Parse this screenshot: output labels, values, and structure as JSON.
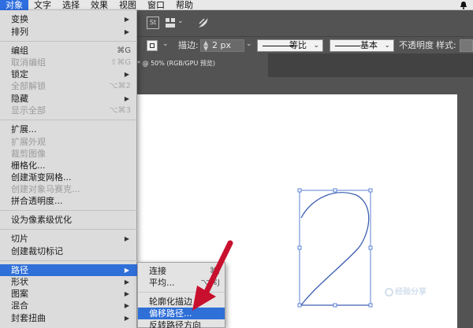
{
  "menubar": {
    "items": [
      "对象",
      "文字",
      "选择",
      "效果",
      "视图",
      "窗口",
      "帮助"
    ]
  },
  "controlbar": {
    "st_label": "St"
  },
  "optionsbar": {
    "stroke_label": "描边:",
    "stroke_value": "2 px",
    "profile1_label": "等比",
    "profile2_label": "基本",
    "opacity_label": "不透明度",
    "style_label": "样式:"
  },
  "document_tab": {
    "title": "* @ 50% (RGB/GPU 预览)"
  },
  "object_menu": {
    "transform": "变换",
    "arrange": "排列",
    "group": "编组",
    "group_sc": "⌘G",
    "ungroup": "取消编组",
    "ungroup_sc": "⇧⌘G",
    "lock": "锁定",
    "unlock_all": "全部解锁",
    "unlock_all_sc": "⌥⌘2",
    "hide": "隐藏",
    "show_all": "显示全部",
    "show_all_sc": "⌥⌘3",
    "expand": "扩展...",
    "expand_appearance": "扩展外观",
    "crop_image": "裁剪图像",
    "rasterize": "栅格化...",
    "gradient_mesh": "创建渐变网格...",
    "object_mosaic": "创建对象马赛克...",
    "flatten_transparency": "拼合透明度...",
    "pixel_optimize": "设为像素级优化",
    "slice": "切片",
    "trim_marks": "创建裁切标记",
    "path": "路径",
    "shape": "形状",
    "pattern": "图案",
    "blend": "混合",
    "envelope_distort": "封套扭曲"
  },
  "path_submenu": {
    "join": "连接",
    "join_sc": "⌘J",
    "average": "平均...",
    "average_sc": "⌥⌘J",
    "outline_stroke": "轮廓化描边",
    "offset_path": "偏移路径...",
    "reverse_path": "反转路径方向"
  },
  "watermark": {
    "text": "经验分享"
  },
  "colors": {
    "highlight": "#2f6fd8",
    "menu_bg": "#dcdcdc",
    "app_bg": "#535353",
    "arrow_red": "#c8102e"
  }
}
